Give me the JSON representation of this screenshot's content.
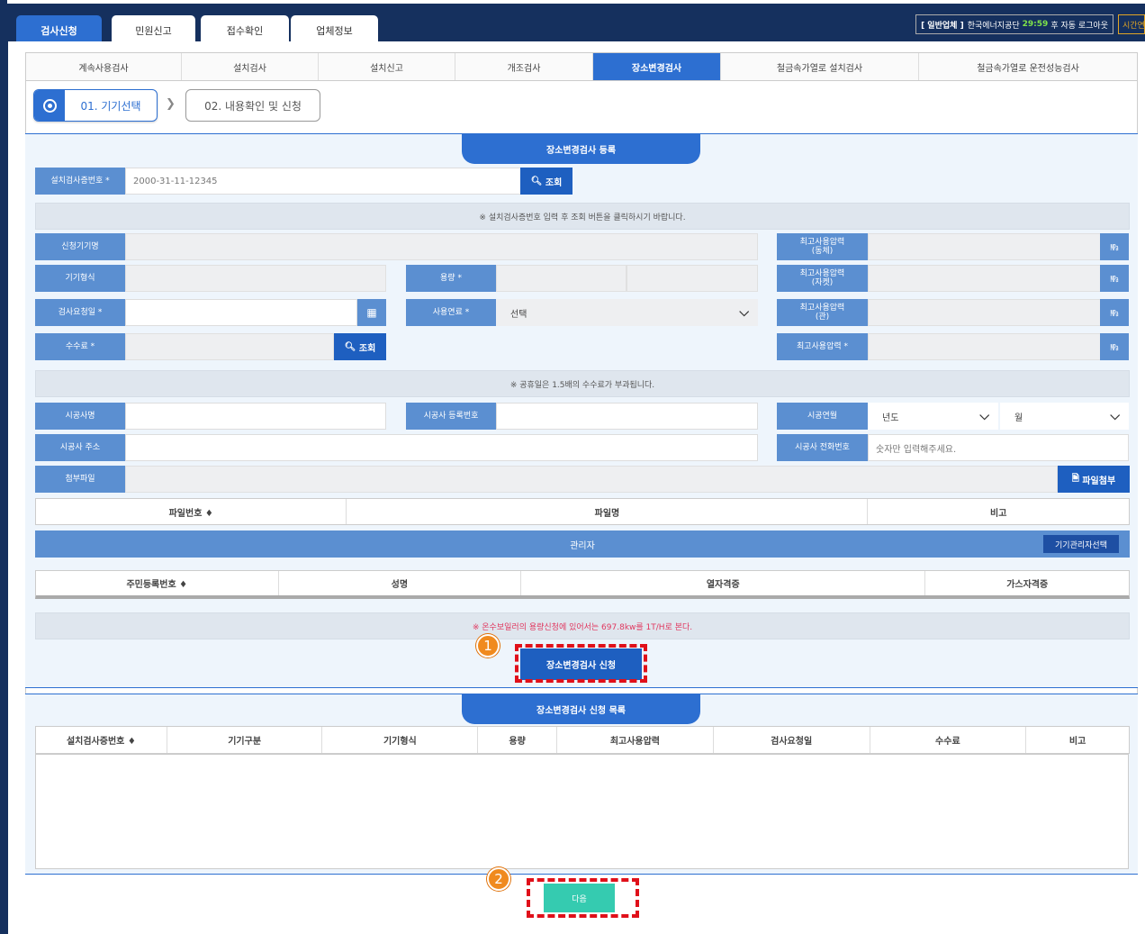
{
  "header": {
    "tabs": [
      {
        "label": "검사신청",
        "active": true
      },
      {
        "label": "민원신고",
        "active": false
      },
      {
        "label": "접수확인",
        "active": false
      },
      {
        "label": "업체정보",
        "active": false
      }
    ],
    "session": {
      "user": "[ 일반업체 ]",
      "org": "한국에너지공단",
      "timer": "29:59",
      "suffix": "후 자동 로그아웃",
      "extend": "시간연장"
    }
  },
  "subtabs": [
    {
      "label": "계속사용검사"
    },
    {
      "label": "설치검사"
    },
    {
      "label": "설치신고"
    },
    {
      "label": "개조검사"
    },
    {
      "label": "장소변경검사",
      "active": true
    },
    {
      "label": "철금속가열로 설치검사"
    },
    {
      "label": "철금속가열로 운전성능검사"
    }
  ],
  "steps": {
    "step1": "01. 기기선택",
    "step2": "02. 내용확인 및 신청"
  },
  "form": {
    "title": "장소변경검사 등록",
    "cert_label": "설치검사증번호 *",
    "cert_placeholder": "2000-31-11-12345",
    "search_label": "조회",
    "notice1": "※ 설치검사증번호 입력 후 조회 버튼을 클릭하시기 바랍니다.",
    "device_name": "신청기기명",
    "device_type": "기기형식",
    "capacity": "용량 *",
    "request_date": "검사요청일 *",
    "fuel": "사용연료 *",
    "fuel_value": "선택",
    "fee": "수수료 *",
    "fee_search": "조회",
    "p_steam_1": "최고사용압력",
    "p_steam_2": "(동체)",
    "p_jacket_1": "최고사용압력",
    "p_jacket_2": "(자켓)",
    "p_pipe_1": "최고사용압력",
    "p_pipe_2": "(관)",
    "p_max": "최고사용압력 *",
    "unit_btn": "㎫",
    "notice2": "※ 공휴일은 1.5배의 수수료가 부과됩니다.",
    "contractor": "시공사명",
    "contractor_reg": "시공사 등록번호",
    "build_ym": "시공연월",
    "year": "년도",
    "month": "월",
    "address": "시공사 주소",
    "phone": "시공사 전화번호",
    "phone_placeholder": "숫자만 입력해주세요.",
    "attach": "첨부파일",
    "attach_btn": "파일첨부",
    "file_cols": [
      "파일번호 ♦",
      "파일명",
      "비고"
    ],
    "manager": "관리자",
    "manager_btn": "기기관리자선택",
    "manager_cols": [
      "주민등록번호 ♦",
      "성명",
      "열자격증",
      "가스자격증"
    ],
    "warning": "※ 온수보일러의 용량신청에 있어서는 697.8kw를 1T/H로 본다.",
    "submit": "장소변경검사 신청"
  },
  "list": {
    "title": "장소변경검사 신청 목록",
    "cols": [
      "설치검사증번호 ♦",
      "기기구분",
      "기기형식",
      "용량",
      "최고사용압력",
      "검사요청일",
      "수수료",
      "비고"
    ]
  },
  "footer": {
    "next": "다음"
  },
  "annotations": {
    "b1": "1",
    "b2": "2"
  }
}
